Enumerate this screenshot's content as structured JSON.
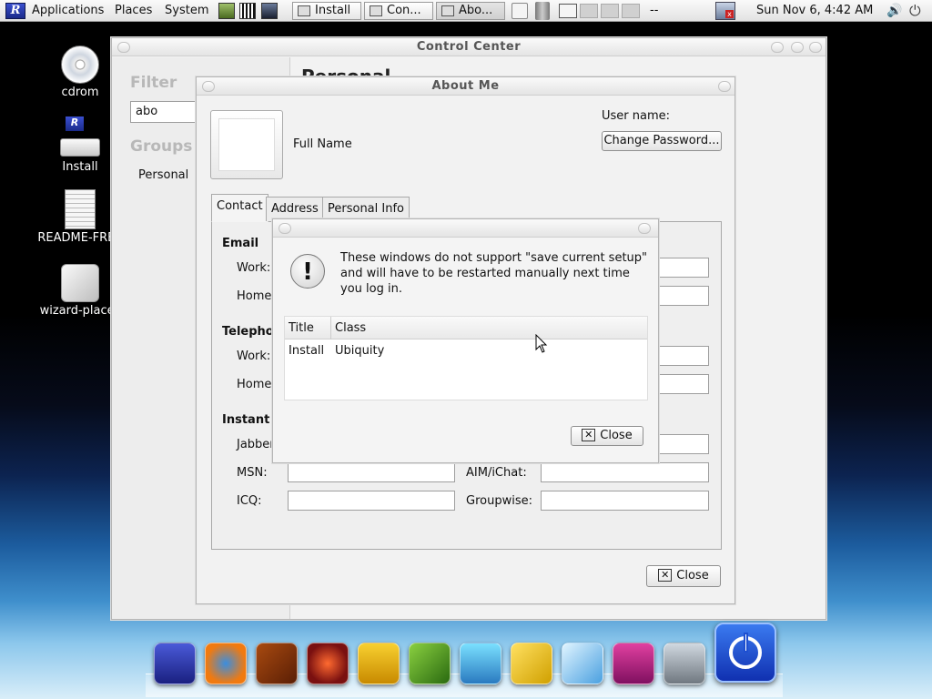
{
  "panel": {
    "menus": [
      "Applications",
      "Places",
      "System"
    ],
    "tasks": [
      "Install",
      "Con...",
      "Abo..."
    ],
    "dashes": "--",
    "clock": "Sun Nov  6,  4:42 AM"
  },
  "desktop": {
    "icons": [
      {
        "label": "cdrom"
      },
      {
        "label": "Install"
      },
      {
        "label": "README-FREE"
      },
      {
        "label": "wizard-places"
      }
    ]
  },
  "control_center": {
    "title": "Control Center",
    "filter_heading": "Filter",
    "filter_value": "abo",
    "groups_heading": "Groups",
    "group_item": "Personal",
    "section_title": "Personal"
  },
  "about_me": {
    "title": "About Me",
    "full_name": "Full Name",
    "user_name_label": "User name:",
    "change_password": "Change Password...",
    "tabs": [
      "Contact",
      "Address",
      "Personal Info"
    ],
    "email_header": "Email",
    "telephone_header": "Telepho",
    "instant_header": "Instant",
    "work1": "Work:",
    "home1": "Home",
    "work2": "Work:",
    "home2": "Home",
    "jabber": "Jabber",
    "msn": "MSN:",
    "icq": "ICQ:",
    "aim": "AIM/iChat:",
    "groupwise": "Groupwise:",
    "close": "Close"
  },
  "dialog": {
    "message": "These windows do not support \"save current setup\" and will have to be restarted manually next time you log in.",
    "columns": [
      "Title",
      "Class"
    ],
    "rows": [
      {
        "title": "Install",
        "class": "Ubiquity"
      }
    ],
    "close": "Close"
  },
  "colors": {
    "dock_power": "#1e4fd0",
    "accent": "#2a6fd6"
  }
}
